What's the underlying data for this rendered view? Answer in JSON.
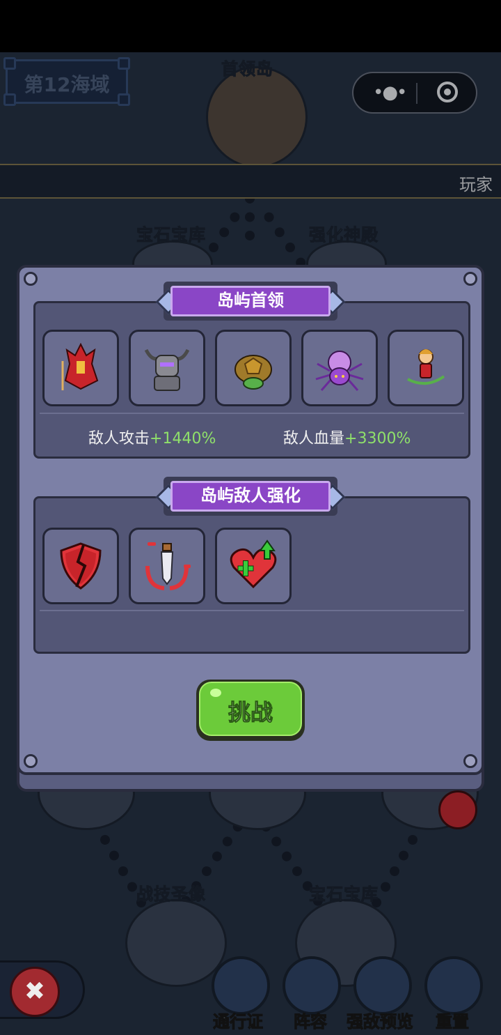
{
  "top_bar": {
    "sea_region": "第12海域",
    "boss_island_label": "首领岛",
    "ticker_text": "玩家"
  },
  "map": {
    "island_labels_top": [
      "宝石宝库",
      "强化神殿"
    ],
    "island_labels_bottom": [
      "战技圣像",
      "宝石宝库"
    ]
  },
  "dialog": {
    "boss_section_title": "岛屿首领",
    "boss_icons": [
      "crimson-knight-icon",
      "horned-armor-warrior-icon",
      "turtle-icon",
      "purple-spider-icon",
      "winged-archer-icon"
    ],
    "stats": [
      {
        "label": "敌人攻击",
        "value": "+1440%"
      },
      {
        "label": "敌人血量",
        "value": "+3300%"
      }
    ],
    "buff_section_title": "岛屿敌人强化",
    "buff_icons": [
      "broken-shield-icon",
      "sword-slash-icon",
      "heart-heal-icon"
    ],
    "challenge_label": "挑战"
  },
  "bottom_nav": {
    "items": [
      "通行证",
      "阵容",
      "强敌预览",
      "重置"
    ]
  },
  "colors": {
    "panel": "#7c80a6",
    "banner": "#8a46c6",
    "stat_value": "#8fe06a",
    "challenge": "#6ccb3a"
  }
}
